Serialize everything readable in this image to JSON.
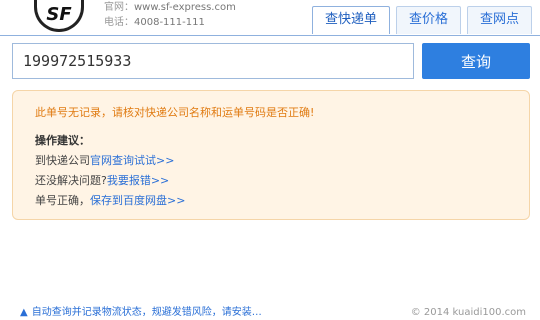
{
  "header": {
    "logo_text": "SF",
    "website_label": "官网：",
    "website": "www.sf-express.com",
    "phone_label": "电话：",
    "phone": "4008-111-111"
  },
  "tabs": [
    {
      "label": "查快递单",
      "active": true
    },
    {
      "label": "查价格",
      "active": false
    },
    {
      "label": "查网点",
      "active": false
    }
  ],
  "search": {
    "value": "199972515933",
    "button_label": "查询"
  },
  "result": {
    "warning": "此单号无记录，请核对快递公司名称和运单号码是否正确!",
    "suggest_title": "操作建议：",
    "line1_text": "到快递公司",
    "line1_link": "官网查询试试>>",
    "line2_text": "还没解决问题?",
    "line2_link": "我要报错>>",
    "line3_text": "单号正确，",
    "line3_link": "保存到百度网盘>>"
  },
  "footer": {
    "left_link": "自动查询并记录物流状态，规避发错风险，请安装…",
    "copyright": "© 2014 kuaidi100.com"
  },
  "colors": {
    "accent": "#2e7fe0",
    "warning": "#e07b12",
    "panel_bg": "#fff4e5"
  }
}
